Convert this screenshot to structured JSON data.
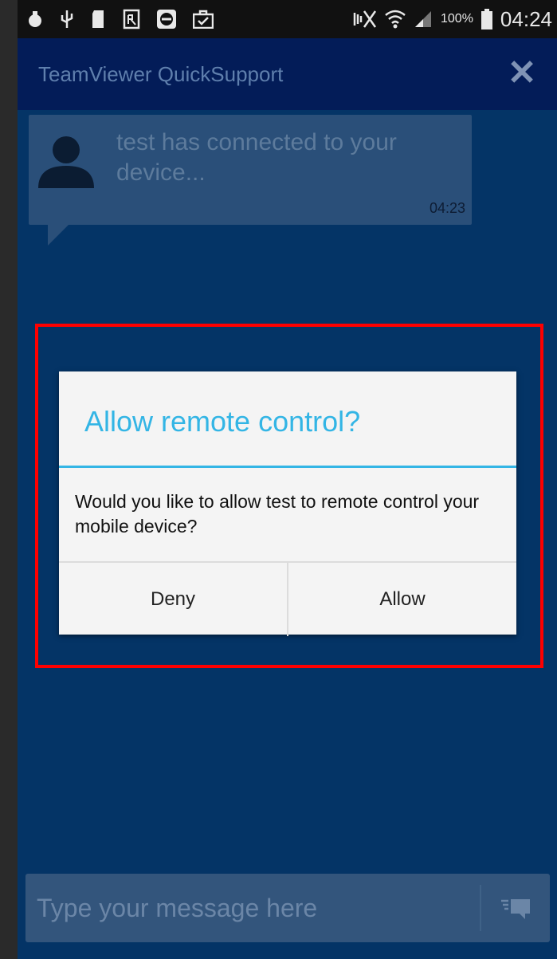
{
  "status_bar": {
    "icons": [
      "security-icon",
      "usb-icon",
      "sd-card-icon",
      "prescription-icon",
      "teamviewer-icon",
      "briefcase-icon"
    ],
    "right_icons": [
      "mute-icon",
      "wifi-icon",
      "signal-icon"
    ],
    "battery": "100%",
    "clock": "04:24"
  },
  "app_bar": {
    "title": "TeamViewer QuickSupport",
    "close_icon": "close-icon"
  },
  "chat": {
    "message": "test has connected to your device...",
    "time": "04:23",
    "avatar_icon": "user-silhouette-icon"
  },
  "dialog": {
    "title": "Allow remote control?",
    "message": "Would you like to allow test to remote control your mobile device?",
    "deny_label": "Deny",
    "allow_label": "Allow"
  },
  "input": {
    "placeholder": "Type your message here",
    "send_icon": "send-message-icon"
  },
  "colors": {
    "background": "#043466",
    "app_bar": "#031c58",
    "accent": "#33b5e5",
    "highlight": "#ff0000"
  }
}
